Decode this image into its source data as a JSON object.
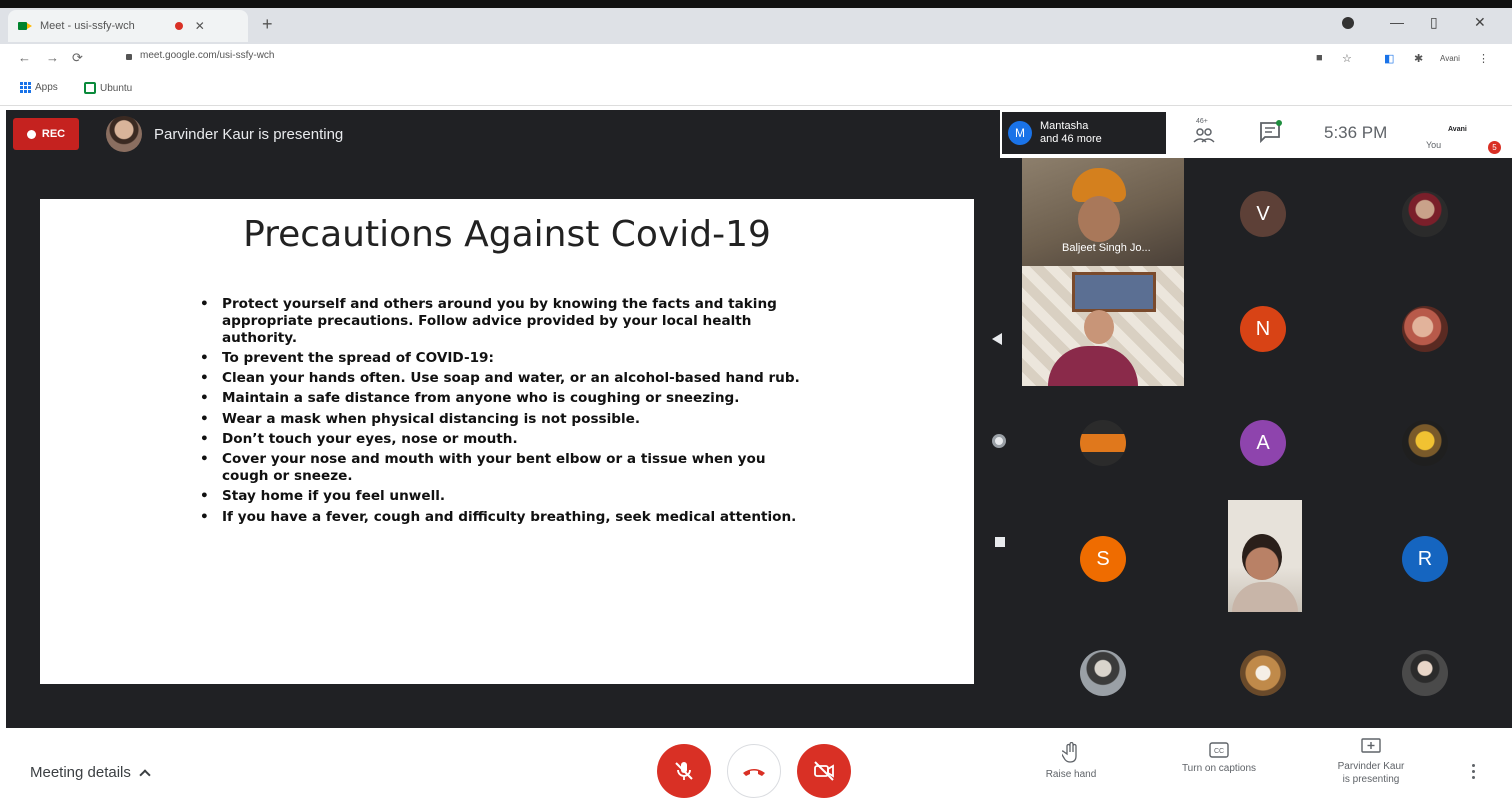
{
  "browser": {
    "tab_title": "Meet - usi-ssfy-wch",
    "url": "meet.google.com/usi-ssfy-wch",
    "bookmarks": [
      "Apps",
      "Ubuntu"
    ],
    "profile_label": "Avani"
  },
  "meet": {
    "rec_label": "REC",
    "presenting_text": "Parvinder Kaur is presenting",
    "participants_summary": {
      "initial": "M",
      "line1": "Mantasha",
      "line2": "and 46 more"
    },
    "people_count": "46+",
    "clock": "5:36 PM",
    "you_label": "You",
    "you_name": "Avani",
    "notification_count": "5"
  },
  "slide": {
    "title": "Precautions Against Covid-19",
    "bullets": [
      "Protect yourself and others around you by knowing the facts and taking appropriate precautions. Follow advice provided by your local health authority.",
      "To prevent the spread of COVID-19:",
      "Clean your hands often. Use soap and water, or an alcohol-based hand rub.",
      "Maintain a safe distance from anyone who is coughing or sneezing.",
      "Wear a mask when physical distancing is not possible.",
      "Don’t touch your eyes, nose or mouth.",
      "Cover your nose and mouth with your bent elbow or a tissue when you cough or sneeze.",
      "Stay home if you feel unwell.",
      "If you have a fever, cough and difficulty breathing, seek medical attention."
    ]
  },
  "participants": {
    "video1_label": "Baljeet Singh Jo...",
    "avatar_v": {
      "initial": "V",
      "color": "#5d4037"
    },
    "avatar_n": {
      "initial": "N",
      "color": "#d84315"
    },
    "avatar_a": {
      "initial": "A",
      "color": "#8e44ad"
    },
    "avatar_s": {
      "initial": "S",
      "color": "#ef6c00"
    },
    "avatar_r": {
      "initial": "R",
      "color": "#1565c0"
    }
  },
  "bottombar": {
    "meeting_details": "Meeting details",
    "raise_hand": "Raise hand",
    "captions": "Turn on captions",
    "presenting_line1": "Parvinder Kaur",
    "presenting_line2": "is presenting"
  }
}
